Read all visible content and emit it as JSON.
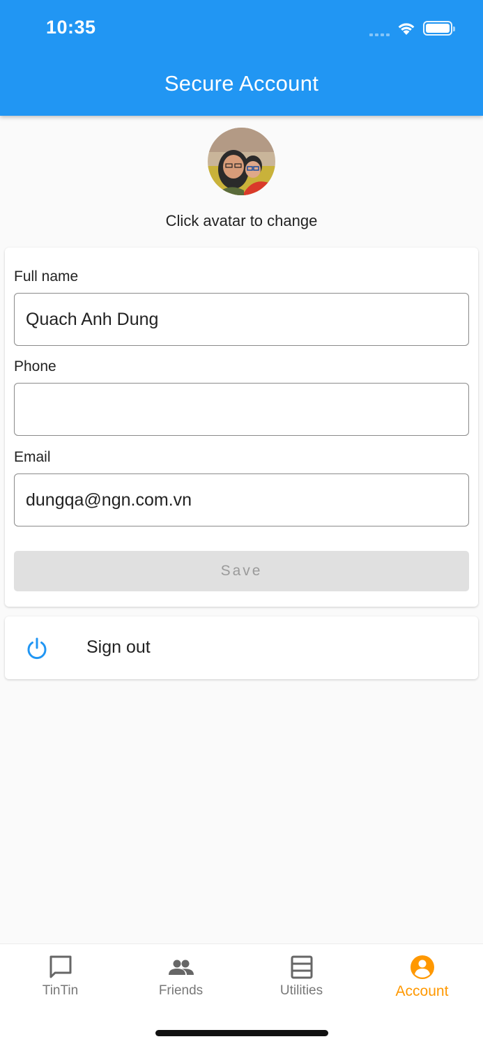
{
  "status_bar": {
    "time": "10:35"
  },
  "app_bar": {
    "title": "Secure Account"
  },
  "avatar": {
    "hint": "Click avatar to change"
  },
  "form": {
    "full_name": {
      "label": "Full name",
      "value": "Quach Anh Dung"
    },
    "phone": {
      "label": "Phone",
      "value": ""
    },
    "email": {
      "label": "Email",
      "value": "dungqa@ngn.com.vn"
    },
    "save_label": "Save"
  },
  "sign_out": {
    "label": "Sign out",
    "icon": "power-icon"
  },
  "bottom_nav": {
    "items": [
      {
        "label": "TinTin",
        "icon": "chat-bubble-icon"
      },
      {
        "label": "Friends",
        "icon": "people-icon"
      },
      {
        "label": "Utilities",
        "icon": "list-icon"
      },
      {
        "label": "Account",
        "icon": "account-circle-icon"
      }
    ],
    "active": "Account"
  },
  "colors": {
    "app_bar": "#2196f3",
    "active_tab": "#ff9800",
    "sign_out_icon": "#2196f3",
    "disabled_button": "#e0e0e0"
  }
}
